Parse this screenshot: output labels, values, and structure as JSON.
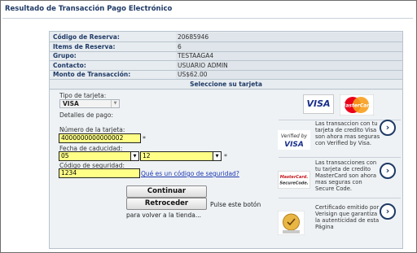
{
  "page": {
    "title": "Resultado de Transacción Pago Electrónico"
  },
  "reservation": {
    "rows": [
      {
        "label": "Código de Reserva:",
        "value": "20685946"
      },
      {
        "label": "Items de Reserva:",
        "value": "6"
      },
      {
        "label": "Grupo:",
        "value": "TESTAAGA4"
      },
      {
        "label": "Contacto:",
        "value": "USUARIO ADMIN"
      },
      {
        "label": "Monto de Transacción:",
        "value": "US$62.00"
      }
    ]
  },
  "card_section": {
    "header": "Seleccione su tarjeta"
  },
  "form": {
    "card_type_label": "Tipo de tarjeta:",
    "card_type_value": "VISA",
    "payment_details_label": "Detalles de pago:",
    "card_number_label": "Número de la tarjeta:",
    "card_number_value": "4000000000000002",
    "expiry_label": "Fecha de caducidad:",
    "expiry_month": "05",
    "expiry_year": "12",
    "security_code_label": "Código de seguridad:",
    "security_code_value": "1234",
    "security_code_link": "Qué es un código de seguridad?",
    "required_mark": "*",
    "continue_button": "Continuar",
    "back_button": "Retroceder",
    "back_hint_1": "Pulse este botón",
    "back_hint_2": "para volver a la tienda..."
  },
  "promos": {
    "visa_logo_text": "VISA",
    "mastercard_logo_text": "MasterCard",
    "verified_by_visa": {
      "logo_line1": "Verified by",
      "logo_line2": "VISA",
      "text": "Las transaccion con tu tarjeta de credito Visa son ahora mas seguras con Verified by Visa."
    },
    "securecode": {
      "logo_line1": "MasterCard.",
      "logo_line2": "SecureCode.",
      "text": "Las transacciones con tu tarjeta de credito MasterCard son ahora mas seguras con Secure Code."
    },
    "verisign": {
      "text": "Certificado emitido por Verisign que garantiza la autenticidad de esta Página"
    },
    "go_icon": "chevron-right-circle-icon"
  },
  "colors": {
    "title": "#1f3a66",
    "panel": "#e7ecf0",
    "input_highlight": "#ffff88",
    "visa_blue": "#1a2e8a",
    "mc_red": "#eb001b",
    "mc_orange": "#f79e1b"
  }
}
